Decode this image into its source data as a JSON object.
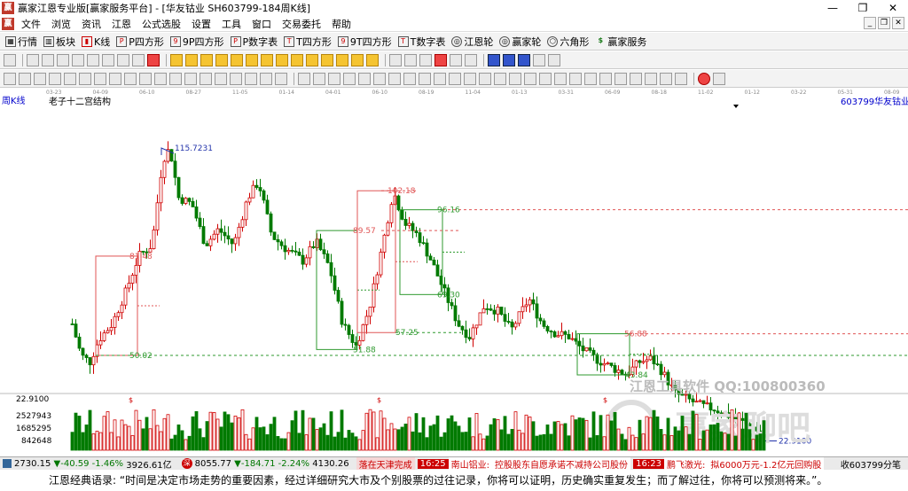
{
  "window": {
    "title": "赢家江恩专业版[赢家服务平台] - [华友钴业  SH603799-184周K线]",
    "buttons": [
      "—",
      "❐",
      "✕"
    ]
  },
  "menu": {
    "items": [
      "文件",
      "浏览",
      "资讯",
      "江恩",
      "公式选股",
      "设置",
      "工具",
      "窗口",
      "交易委托",
      "帮助"
    ]
  },
  "toolbar": {
    "items": [
      "行情",
      "板块",
      "K线",
      "P四方形",
      "9P四方形",
      "P数字表",
      "T四方形",
      "9T四方形",
      "T数字表",
      "江恩轮",
      "赢家轮",
      "六角形",
      "赢家服务"
    ]
  },
  "datebar": {
    "labels": [
      "03-23",
      "04-09",
      "06-10",
      "08-27",
      "11-05",
      "01-14",
      "04-01",
      "06-10",
      "08-19",
      "11-04",
      "01-13",
      "03-31",
      "06-09",
      "08-18",
      "11-02",
      "01-12",
      "03-22",
      "05-31",
      "08-09"
    ]
  },
  "chart_header": {
    "period": "周K线",
    "structure": "老子十二宫结构",
    "stock_code": "603799",
    "stock_name": "华友钴业"
  },
  "chart_data": {
    "type": "candlestick",
    "ylim": [
      22.91,
      115.7231
    ],
    "price_labels": [
      {
        "text": "115.7231"
      },
      {
        "text": "102.18"
      },
      {
        "text": "96.16"
      },
      {
        "text": "89.57"
      },
      {
        "text": "81.48"
      },
      {
        "text": "69.30"
      },
      {
        "text": "57.25"
      },
      {
        "text": "56.88"
      },
      {
        "text": "51.88"
      },
      {
        "text": "50.02"
      },
      {
        "text": "43.84"
      },
      {
        "text": "22.9100"
      }
    ],
    "price_axis_left": "22.9100",
    "volume_axis": [
      "2527943",
      "1685295",
      "842648"
    ],
    "watermark": "江恩工具软件  QQ:100800360",
    "watermark2": "赢家聊吧"
  },
  "statusbar": {
    "idx1": {
      "value": "2730.15",
      "change": "▼-40.59",
      "pct": "-1.46%",
      "amount": "3926.61亿"
    },
    "idx2": {
      "value": "8055.77",
      "change": "▼-184.71",
      "pct": "-2.24%",
      "amount": "4130.26"
    },
    "news1": "落在天津完成",
    "time1": "16:25",
    "news_title": "南山铝业:",
    "news_text": "控股股东自愿承诺不减持公司股份",
    "time2": "16:23",
    "news2": "鹏飞激光:",
    "news3": "拟6000万元-1.2亿元回购股",
    "right": "收603799分笔"
  },
  "quote": {
    "label": "江恩经典语录:",
    "text": "“时间是决定市场走势的重要因素，经过详细研究大市及个别股票的过往记录，你将可以证明，历史确实重复发生；而了解过往，你将可以预测将来。”。"
  },
  "colors": {
    "up": "#d00000",
    "down": "#007a00",
    "dashed_red": "#e05555",
    "dashed_green": "#2f9a2f"
  }
}
